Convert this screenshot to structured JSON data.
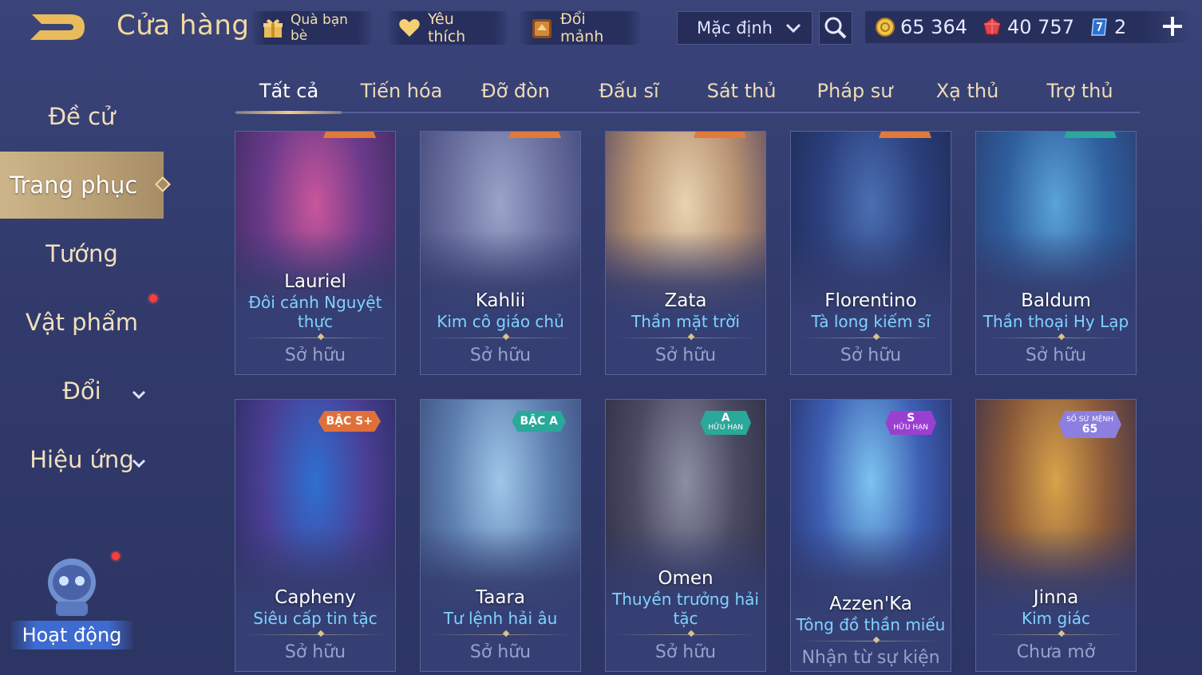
{
  "header": {
    "title": "Cửa hàng",
    "buttons": [
      {
        "label": "Quà bạn bè",
        "icon": "gift-icon"
      },
      {
        "label": "Yêu thích",
        "icon": "heart-icon"
      },
      {
        "label": "Đổi mảnh",
        "icon": "fragment-chest-icon"
      }
    ],
    "sort_value": "Mặc định",
    "currencies": [
      {
        "icon": "gold-coin-icon",
        "value": "65 364",
        "color": "#f1c24a"
      },
      {
        "icon": "red-gem-icon",
        "value": "40 757",
        "color": "#e0474f"
      },
      {
        "icon": "voucher-icon",
        "value": "2",
        "color": "#7fb8ff"
      }
    ]
  },
  "sidebar": {
    "items": [
      {
        "label": "Đề cử"
      },
      {
        "label": "Trang phục",
        "active": true
      },
      {
        "label": "Tướng"
      },
      {
        "label": "Vật phẩm",
        "badge": true
      },
      {
        "label": "Đổi",
        "expandable": true
      },
      {
        "label": "Hiệu ứng",
        "expandable": true
      }
    ],
    "activity_label": "Hoạt động"
  },
  "tabs": [
    {
      "label": "Tất cả",
      "active": true
    },
    {
      "label": "Tiến hóa"
    },
    {
      "label": "Đỡ đòn"
    },
    {
      "label": "Đấu sĩ"
    },
    {
      "label": "Sát thủ"
    },
    {
      "label": "Pháp sư"
    },
    {
      "label": "Xạ thủ"
    },
    {
      "label": "Trợ thủ"
    }
  ],
  "skins": [
    {
      "hero": "Lauriel",
      "skin": "Đôi cánh Nguyệt thực",
      "status": "Sở hữu",
      "colors": [
        "#c9569b",
        "#6b3a8a",
        "#3a2c5e"
      ]
    },
    {
      "hero": "Kahlii",
      "skin": "Kim cô giáo chủ",
      "status": "Sở hữu",
      "colors": [
        "#9aa3c9",
        "#6a6f9e",
        "#3f4676"
      ]
    },
    {
      "hero": "Zata",
      "skin": "Thần mặt trời",
      "status": "Sở hữu",
      "colors": [
        "#e8d3b0",
        "#b89373",
        "#5a4a60"
      ]
    },
    {
      "hero": "Florentino",
      "skin": "Tà long kiếm sĩ",
      "status": "Sở hữu",
      "colors": [
        "#4a6fb3",
        "#2b3f7c",
        "#1f2a55"
      ]
    },
    {
      "hero": "Baldum",
      "skin": "Thần thoại Hy Lạp",
      "status": "Sở hữu",
      "colors": [
        "#5aa3d9",
        "#2f5f9e",
        "#2a3c70"
      ]
    },
    {
      "hero": "Capheny",
      "skin": "Siêu cấp tin tặc",
      "status": "Sở hữu",
      "rank": "BẬC S+",
      "rank_color": "#e0703a",
      "colors": [
        "#2f6fd1",
        "#4a3f95",
        "#2b2b5e"
      ]
    },
    {
      "hero": "Taara",
      "skin": "Tư lệnh hải âu",
      "status": "Sở hữu",
      "rank": "BẬC A",
      "rank_color": "#2aa89a",
      "colors": [
        "#9fc6e8",
        "#5d7fb0",
        "#3a4a7a"
      ]
    },
    {
      "hero": "Omen",
      "skin": "Thuyền trưởng hải tặc",
      "status": "Sở hữu",
      "rank": "A",
      "rank_sub": "HỮU HẠN",
      "rank_color": "#2aa89a",
      "colors": [
        "#8c8fa3",
        "#4b4a63",
        "#2a2b43"
      ]
    },
    {
      "hero": "Azzen'Ka",
      "skin": "Tông đồ thần miếu",
      "status": "Nhận từ sự kiện",
      "rank": "S",
      "rank_sub": "HỮU HẠN",
      "rank_color": "#9b3fd1",
      "colors": [
        "#7cc3f0",
        "#3d5fb3",
        "#28306a"
      ]
    },
    {
      "hero": "Jinna",
      "skin": "Kim giác",
      "status": "Chưa mở",
      "rank": "65",
      "rank_sub": "SỐ SỨ MỆNH",
      "rank_color": "#8c7fe0",
      "colors": [
        "#d9a24a",
        "#8a5a3a",
        "#3a2f4a"
      ]
    }
  ]
}
